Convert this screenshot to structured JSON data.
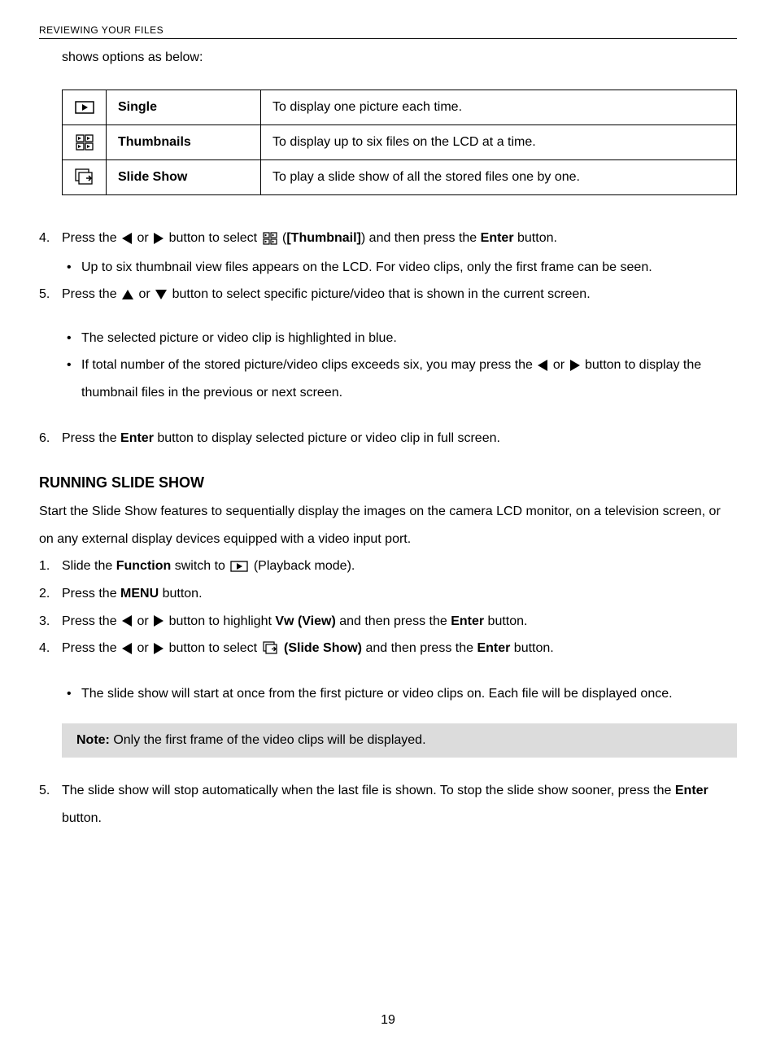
{
  "header": "REVIEWING YOUR FILES",
  "intro": "shows options as below:",
  "table": {
    "rows": [
      {
        "name": "Single",
        "desc": "To display one picture each time."
      },
      {
        "name": "Thumbnails",
        "desc": "To display up to six files on the LCD at a time."
      },
      {
        "name": "Slide Show",
        "desc": "To play a slide show of all the stored files one by one."
      }
    ]
  },
  "step4": {
    "pre": "Press the ",
    "mid1": " or ",
    "mid2": "  button to select ",
    "mid3": " (",
    "thumb_label": "[Thumbnail]",
    "mid4": ") and then press the ",
    "enter": "Enter",
    "post": " button.",
    "bullet1": "Up to six thumbnail view files appears on the LCD. For video clips, only the first frame can be seen."
  },
  "step5": {
    "pre": "Press the  ",
    "mid1": "  or  ",
    "mid2": "  button to select specific picture/video that is shown in the current screen.",
    "bullet1": "The selected picture or video clip is highlighted in blue.",
    "bullet2a": "If total number of the stored picture/video clips exceeds six, you may press the  ",
    "bullet2b": " or  ",
    "bullet2c": "  button to display the thumbnail files in the previous or next screen."
  },
  "step6": {
    "pre": "Press the ",
    "enter": "Enter",
    "post": " button to display selected picture or video clip in full screen."
  },
  "section2": {
    "heading": "RUNNING SLIDE SHOW",
    "intro": "Start the Slide Show features to sequentially display the images on the camera LCD monitor, on a television screen, or on any external display devices equipped with a video input port.",
    "s1a": "Slide the ",
    "s1_func": "Function",
    "s1b": " switch to ",
    "s1c": " (Playback mode).",
    "s2a": "Press the ",
    "s2_menu": "MENU",
    "s2b": " button.",
    "s3a": "Press the ",
    "s3b": " or  ",
    "s3c": "  button to highlight ",
    "s3_vw": "Vw (View)",
    "s3d": " and then press the ",
    "s3_enter": "Enter",
    "s3e": " button.",
    "s4a": "Press the ",
    "s4b": " or  ",
    "s4c": "  button to select  ",
    "s4_ss": " (Slide Show)",
    "s4d": " and then press the ",
    "s4_enter": "Enter",
    "s4e": " button.",
    "bullet1": "The slide show will start at once from the first picture or video clips on. Each file will be displayed once."
  },
  "note": {
    "label": "Note:",
    "text": " Only the first frame of the video clips will be displayed."
  },
  "step5b": {
    "text_a": "The slide show will stop automatically when the last file is shown. To stop the slide show sooner, press the ",
    "enter": "Enter",
    "text_b": " button."
  },
  "page_number": "19"
}
